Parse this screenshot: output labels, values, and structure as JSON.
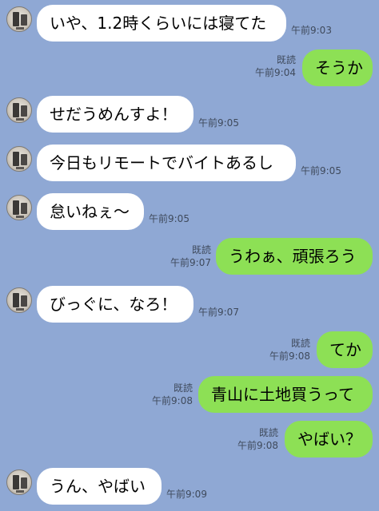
{
  "messages": [
    {
      "side": "in",
      "text": "いや、1.2時くらいには寝てた",
      "time": "午前9:03"
    },
    {
      "side": "out",
      "text": "そうか",
      "read": "既読",
      "time": "午前9:04"
    },
    {
      "side": "in",
      "text": "せだうめんすよ！",
      "time": "午前9:05"
    },
    {
      "side": "in",
      "text": "今日もリモートでバイトあるし",
      "time": "午前9:05"
    },
    {
      "side": "in",
      "text": "怠いねぇ～",
      "time": "午前9:05"
    },
    {
      "side": "out",
      "text": "うわぁ、頑張ろう",
      "read": "既読",
      "time": "午前9:07"
    },
    {
      "side": "in",
      "text": "びっぐに、なろ！",
      "time": "午前9:07"
    },
    {
      "side": "out",
      "text": "てか",
      "read": "既読",
      "time": "午前9:08"
    },
    {
      "side": "out",
      "text": "青山に土地買うって",
      "read": "既読",
      "time": "午前9:08"
    },
    {
      "side": "out",
      "text": "やばい？",
      "read": "既読",
      "time": "午前9:08"
    },
    {
      "side": "in",
      "text": "うん、やばい",
      "time": "午前9:09"
    }
  ],
  "colors": {
    "background": "#8fa8d4",
    "incoming_bubble": "#ffffff",
    "outgoing_bubble": "#8de055",
    "meta_text": "#3f4a5c"
  }
}
